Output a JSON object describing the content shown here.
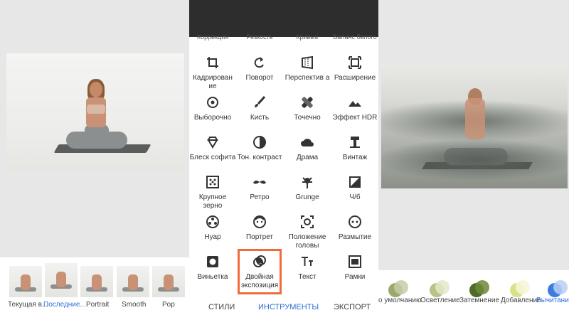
{
  "left_panel": {
    "thumbnails": [
      {
        "label": "Текущая в..."
      },
      {
        "label": "Последние..."
      },
      {
        "label": "Portrait"
      },
      {
        "label": "Smooth"
      },
      {
        "label": "Pop"
      }
    ],
    "selected_index": 1
  },
  "tools": {
    "partial_row": [
      "Коррекция",
      "Резкость",
      "Кривые",
      "Баланс белого"
    ],
    "items": [
      {
        "label": "Кадрирован ие",
        "icon": "crop-icon"
      },
      {
        "label": "Поворот",
        "icon": "rotate-icon"
      },
      {
        "label": "Перспектив а",
        "icon": "perspective-icon"
      },
      {
        "label": "Расширение",
        "icon": "expand-icon"
      },
      {
        "label": "Выборочно",
        "icon": "selective-icon"
      },
      {
        "label": "Кисть",
        "icon": "brush-icon"
      },
      {
        "label": "Точечно",
        "icon": "healing-icon"
      },
      {
        "label": "Эффект HDR",
        "icon": "hdr-icon"
      },
      {
        "label": "Блеск софита",
        "icon": "glamour-glow-icon"
      },
      {
        "label": "Тон. контраст",
        "icon": "tonal-contrast-icon"
      },
      {
        "label": "Драма",
        "icon": "drama-icon"
      },
      {
        "label": "Винтаж",
        "icon": "vintage-icon"
      },
      {
        "label": "Крупное зерно",
        "icon": "grainy-film-icon"
      },
      {
        "label": "Ретро",
        "icon": "retrolux-icon"
      },
      {
        "label": "Grunge",
        "icon": "grunge-icon"
      },
      {
        "label": "Ч/б",
        "icon": "black-white-icon"
      },
      {
        "label": "Нуар",
        "icon": "noir-icon"
      },
      {
        "label": "Портрет",
        "icon": "portrait-icon"
      },
      {
        "label": "Положение головы",
        "icon": "head-pose-icon"
      },
      {
        "label": "Размытие",
        "icon": "blur-icon"
      },
      {
        "label": "Виньетка",
        "icon": "vignette-icon"
      },
      {
        "label": "Двойная экспозиция",
        "icon": "double-exposure-icon"
      },
      {
        "label": "Текст",
        "icon": "text-icon"
      },
      {
        "label": "Рамки",
        "icon": "frames-icon"
      }
    ],
    "highlighted": "Двойная экспозиция",
    "highlight_color": "#f26a3c"
  },
  "tabs": [
    {
      "label": "СТИЛИ"
    },
    {
      "label": "ИНСТРУМЕНТЫ",
      "active": true
    },
    {
      "label": "ЭКСПОРТ"
    }
  ],
  "blend_modes": [
    {
      "label": "о умолчанию",
      "c1": "#9aa86e",
      "c2": "#c5cda8"
    },
    {
      "label": "Осветление",
      "c1": "#b7c487",
      "c2": "#e3e9c8"
    },
    {
      "label": "Затемнение",
      "c1": "#4f6b2a",
      "c2": "#6c8838"
    },
    {
      "label": "Добавление",
      "c1": "#d9e28a",
      "c2": "#f4f7d8"
    },
    {
      "label": "Вычитание",
      "c1": "#3d7be0",
      "c2": "#b9d0f4"
    }
  ],
  "accent_color": "#2f6fd6"
}
